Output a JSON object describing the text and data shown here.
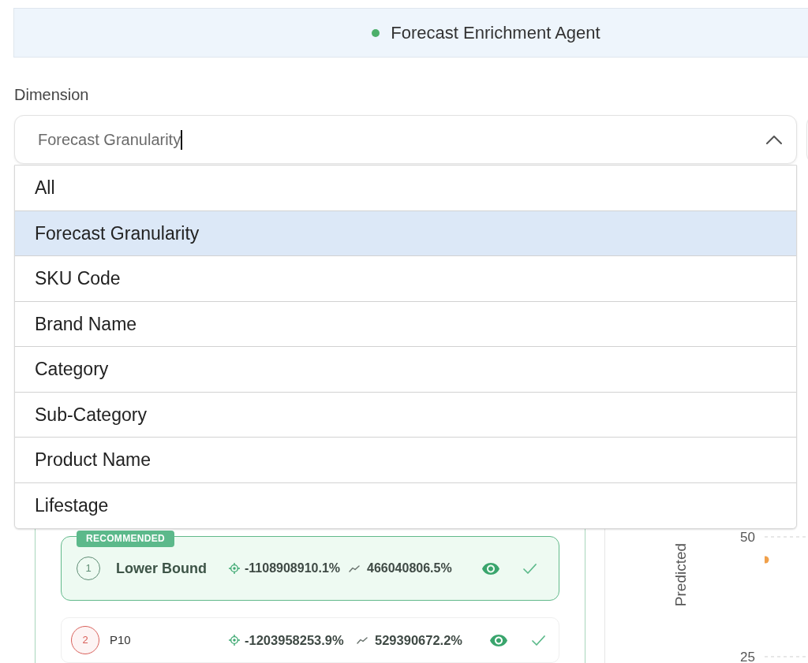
{
  "header": {
    "title": "Forecast Enrichment Agent"
  },
  "dimension": {
    "label": "Dimension",
    "value": "Forecast Granularity",
    "focused": true,
    "expanded": true,
    "options": [
      {
        "label": "All",
        "selected": false
      },
      {
        "label": "Forecast Granularity",
        "selected": true
      },
      {
        "label": "SKU Code",
        "selected": false
      },
      {
        "label": "Brand Name",
        "selected": false
      },
      {
        "label": "Category",
        "selected": false
      },
      {
        "label": "Sub-Category",
        "selected": false
      },
      {
        "label": "Product Name",
        "selected": false
      },
      {
        "label": "Lifestage",
        "selected": false
      }
    ]
  },
  "results": {
    "recommended_badge": "RECOMMENDED",
    "candidates": [
      {
        "rank": "1",
        "name": "Lower Bound",
        "recommended": true,
        "color": "#5e8c74",
        "metric_1": "-1108908910.1%",
        "metric_2": "466040806.5%"
      },
      {
        "rank": "2",
        "name": "P10",
        "recommended": false,
        "color": "#d9605a",
        "metric_1": "-1203958253.9%",
        "metric_2": "529390672.2%"
      }
    ]
  },
  "chart": {
    "axis_title": "Predicted",
    "tick_labels": [
      "50",
      "25"
    ]
  }
}
